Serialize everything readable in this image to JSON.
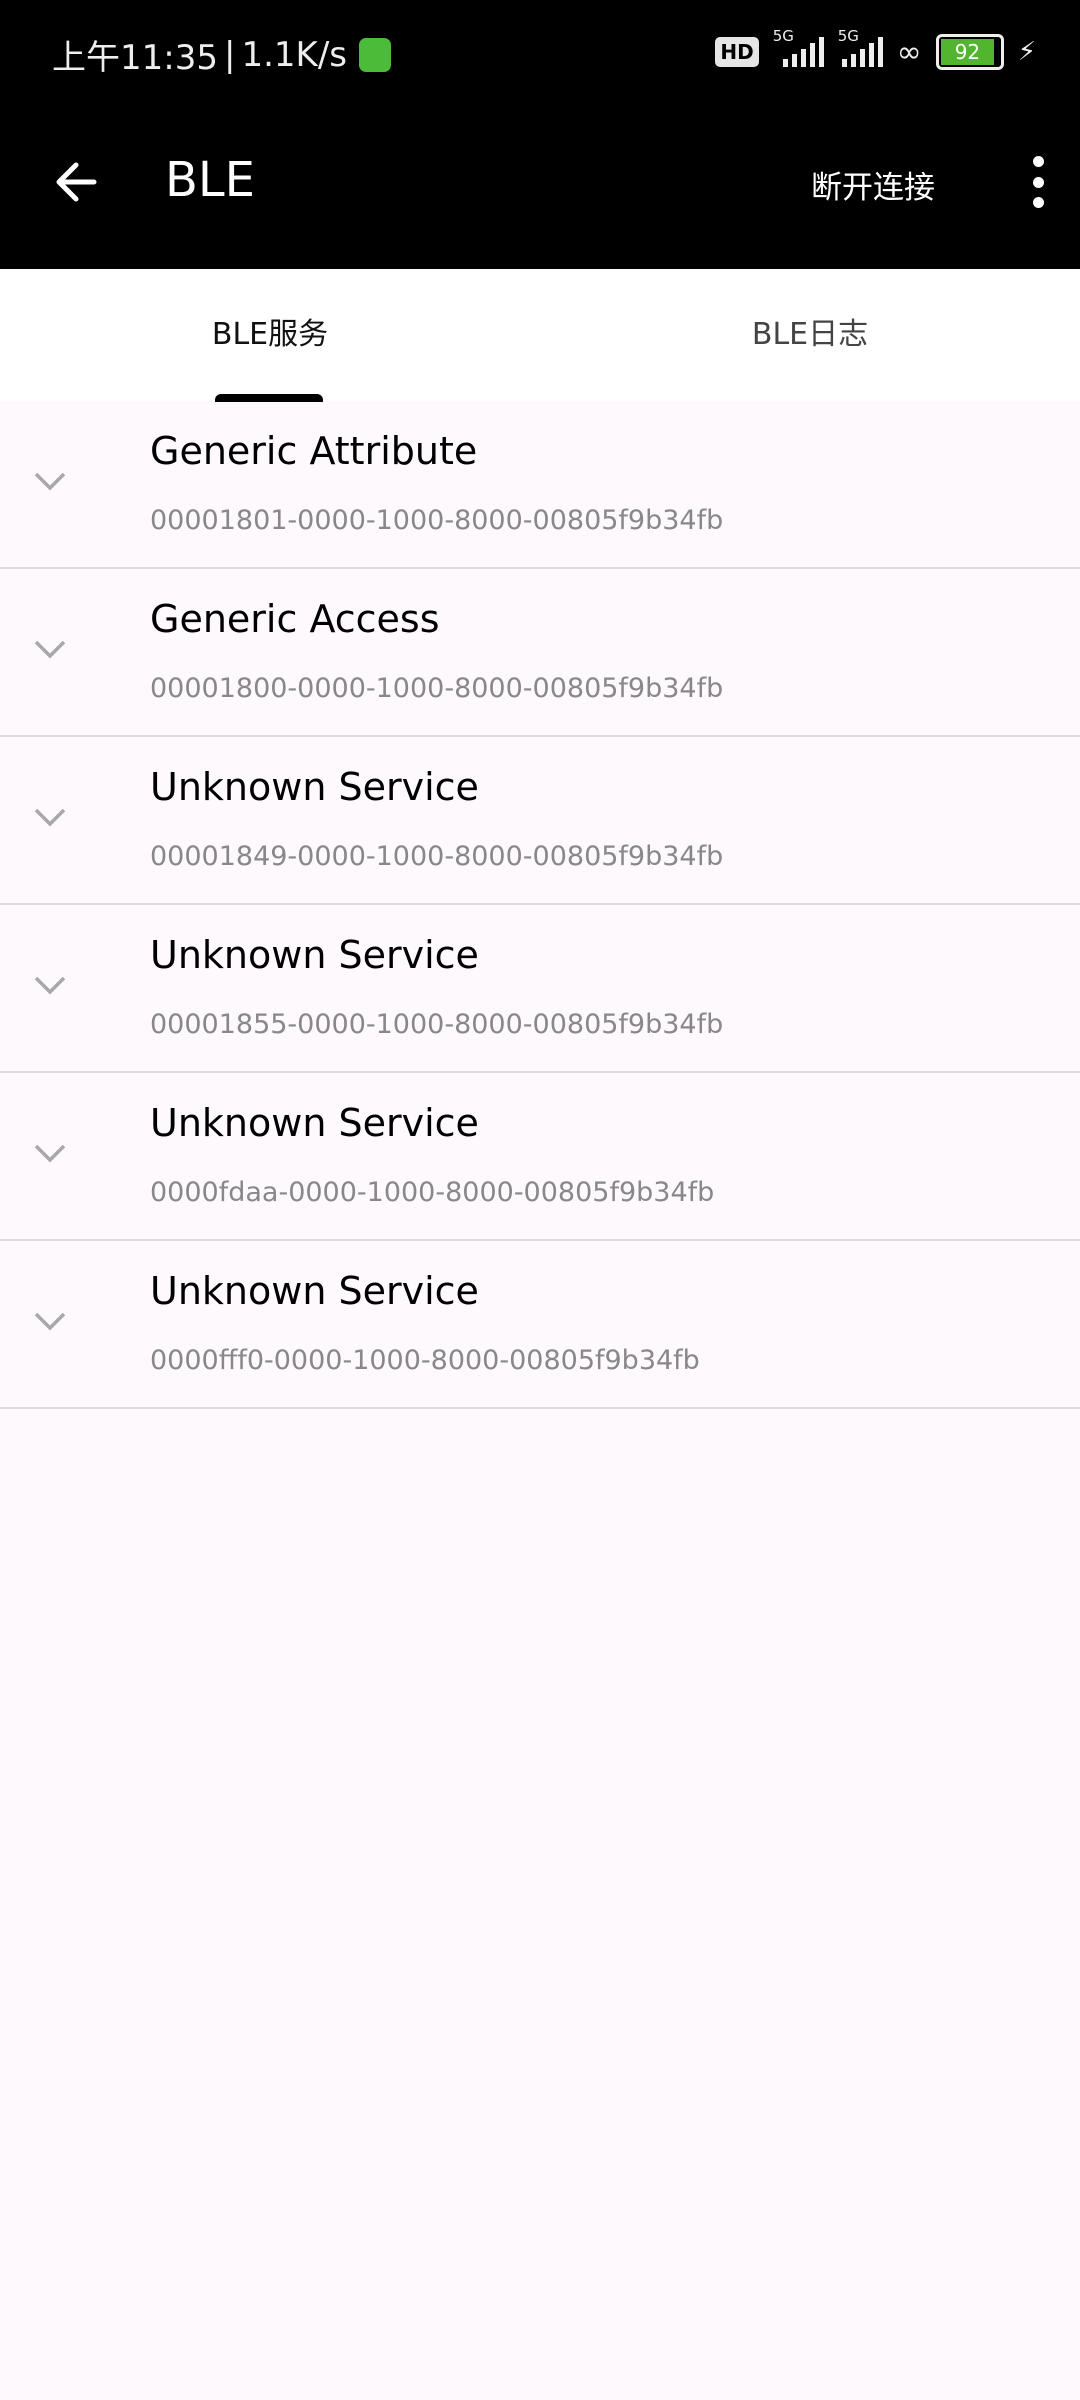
{
  "status_bar": {
    "time": "上午11:35",
    "speed": "1.1K/s",
    "network1": "5G",
    "network2": "5G",
    "hd": "HD",
    "battery": "92",
    "battery_level_percent": 92,
    "battery_color": "#52b52e"
  },
  "app_bar": {
    "title": "BLE",
    "disconnect_label": "断开连接"
  },
  "tabs": [
    {
      "label": "BLE服务",
      "selected": true
    },
    {
      "label": "BLE日志",
      "selected": false
    }
  ],
  "services": [
    {
      "name": "Generic Attribute",
      "uuid": "00001801-0000-1000-8000-00805f9b34fb"
    },
    {
      "name": "Generic Access",
      "uuid": "00001800-0000-1000-8000-00805f9b34fb"
    },
    {
      "name": "Unknown Service",
      "uuid": "00001849-0000-1000-8000-00805f9b34fb"
    },
    {
      "name": "Unknown Service",
      "uuid": "00001855-0000-1000-8000-00805f9b34fb"
    },
    {
      "name": "Unknown Service",
      "uuid": "0000fdaa-0000-1000-8000-00805f9b34fb"
    },
    {
      "name": "Unknown Service",
      "uuid": "0000fff0-0000-1000-8000-00805f9b34fb"
    }
  ]
}
